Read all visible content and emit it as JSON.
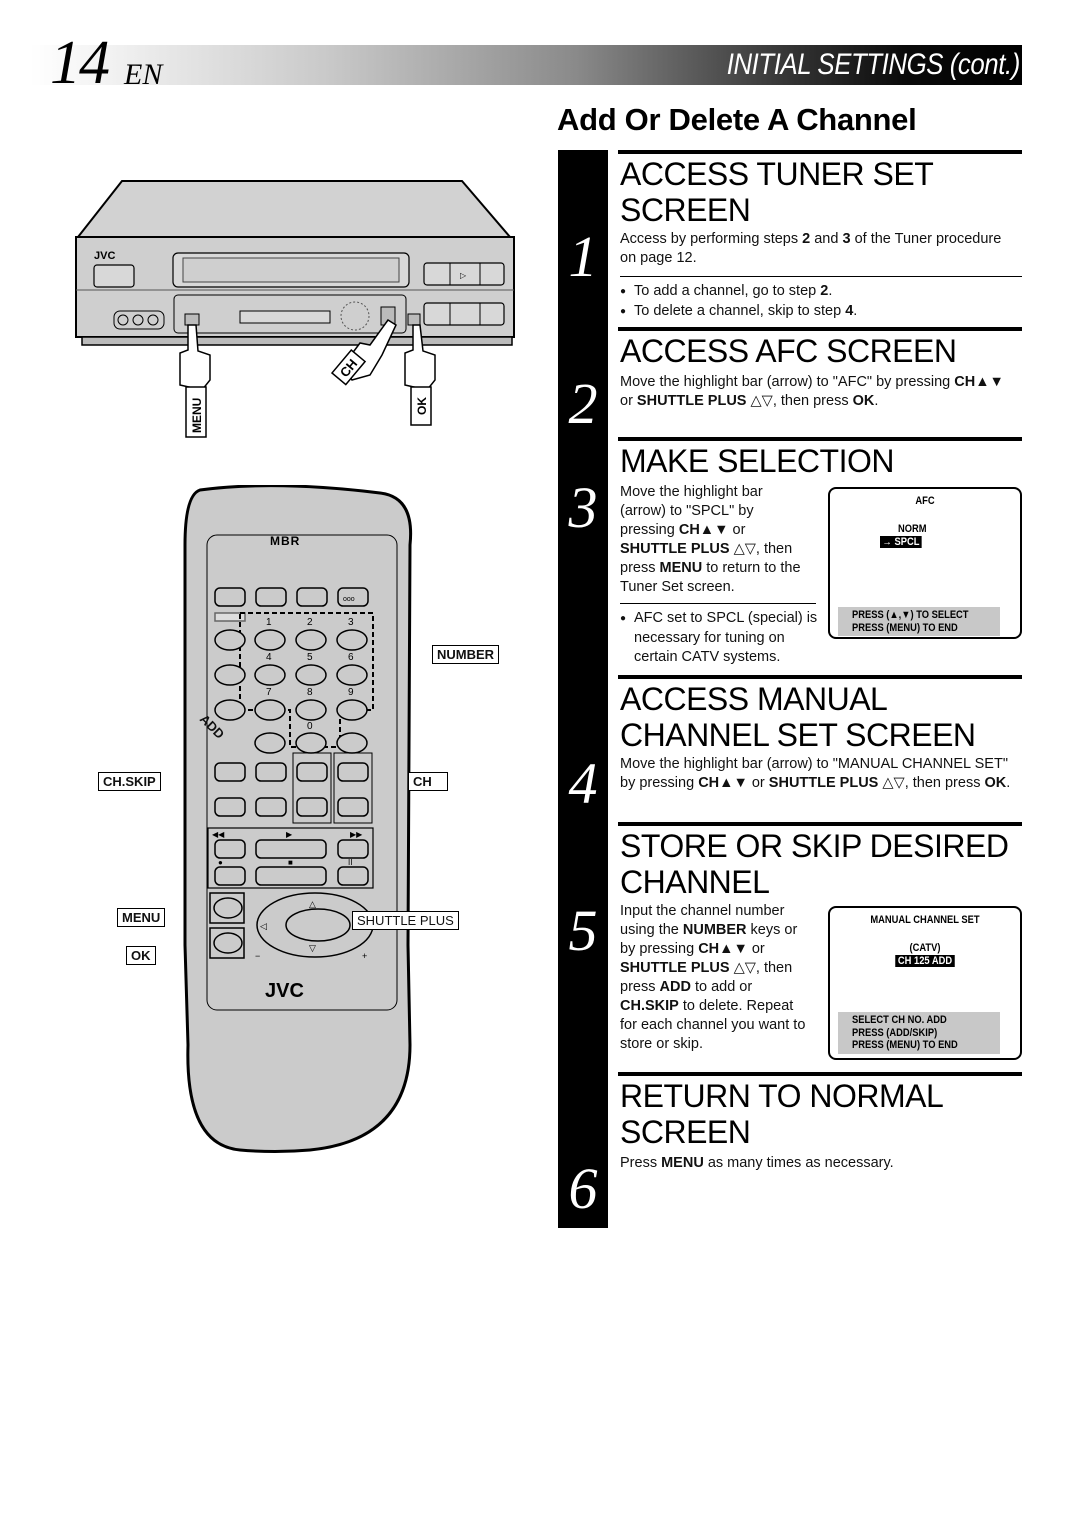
{
  "header": {
    "page_number": "14",
    "page_lang": "EN",
    "section_title": "INITIAL SETTINGS (cont.)",
    "subtitle": "Add Or Delete A Channel"
  },
  "vcr": {
    "brand": "JVC",
    "callouts": {
      "menu": "MENU",
      "ch": "CH",
      "ok": "OK"
    }
  },
  "remote": {
    "logo": "MBR",
    "brand": "JVC",
    "number_keys": [
      "1",
      "2",
      "3",
      "4",
      "5",
      "6",
      "7",
      "8",
      "9",
      "0"
    ],
    "callouts": {
      "number": "NUMBER",
      "add": "ADD",
      "ch_skip": "CH.SKIP",
      "ch": "CH",
      "menu": "MENU",
      "ok": "OK",
      "shuttle_plus": "SHUTTLE PLUS"
    }
  },
  "steps": [
    {
      "number": "1",
      "title_lines": [
        "ACCESS TUNER SET",
        "SCREEN"
      ],
      "text_html": "Access by performing steps <b>2</b> and <b>3</b> of the Tuner procedure on page 12.",
      "bullets_html": [
        "To add a channel, go to step <b>2</b>.",
        "To delete a channel, skip to step <b>4</b>."
      ]
    },
    {
      "number": "2",
      "title_lines": [
        "ACCESS AFC SCREEN"
      ],
      "text_html": "Move the highlight bar (arrow) to \"AFC\" by pressing <b>CH▲▼</b> or <b>SHUTTLE PLUS</b> △▽, then press <b>OK</b>."
    },
    {
      "number": "3",
      "title_lines": [
        "MAKE SELECTION"
      ],
      "text_html": "Move the highlight bar (arrow) to \"SPCL\" by pressing <b>CH▲▼</b> or <b>SHUTTLE PLUS</b> △▽, then press <b>MENU</b> to return to the Tuner Set screen.",
      "bullets_html": [
        "AFC set to SPCL (special) is necessary for tuning on certain CATV systems."
      ],
      "osd": {
        "title": "AFC",
        "options": [
          "NORM",
          "→ SPCL"
        ],
        "selected": "→ SPCL",
        "footer": [
          "PRESS (▲,▼) TO SELECT",
          "PRESS (MENU) TO END"
        ]
      }
    },
    {
      "number": "4",
      "title_lines": [
        "ACCESS MANUAL",
        "CHANNEL SET SCREEN"
      ],
      "text_html": "Move the highlight bar (arrow) to \"MANUAL CHANNEL SET\" by pressing <b>CH▲▼</b> or <b>SHUTTLE PLUS</b> △▽, then press <b>OK</b>."
    },
    {
      "number": "5",
      "title_lines": [
        "STORE OR SKIP DESIRED",
        "CHANNEL"
      ],
      "text_html": "Input the channel number using the <b>NUMBER</b> keys or by pressing <b>CH▲▼</b> or <b>SHUTTLE PLUS</b> △▽, then press <b>ADD</b> to add or <b>CH.SKIP</b> to delete. Repeat for each channel you want to store or skip.",
      "osd": {
        "title": "MANUAL CHANNEL SET",
        "mode": "(CATV)",
        "selected": "CH 125 ADD",
        "footer": [
          "SELECT CH NO. ADD",
          "PRESS (ADD/SKIP)",
          "PRESS (MENU) TO END"
        ]
      }
    },
    {
      "number": "6",
      "title_lines": [
        "RETURN TO NORMAL",
        "SCREEN"
      ],
      "text_html": "Press <b>MENU</b> as many times as necessary."
    }
  ]
}
